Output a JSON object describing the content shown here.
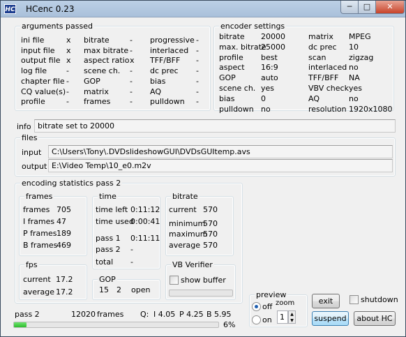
{
  "window": {
    "icon_text": "HC",
    "title": "HCenc 0.23",
    "minimize": "─",
    "maximize": "□",
    "close": "✕"
  },
  "args": {
    "legend": "arguments passed",
    "col1": [
      {
        "label": "ini file",
        "val": "x"
      },
      {
        "label": "input file",
        "val": "x"
      },
      {
        "label": "output file",
        "val": "x"
      },
      {
        "label": "log file",
        "val": "-"
      },
      {
        "label": "chapter file",
        "val": "-"
      },
      {
        "label": "CQ value(s)",
        "val": "-"
      },
      {
        "label": "profile",
        "val": "-"
      }
    ],
    "col2": [
      {
        "label": "bitrate",
        "val": "-"
      },
      {
        "label": "max bitrate",
        "val": "-"
      },
      {
        "label": "aspect ratio",
        "val": "x"
      },
      {
        "label": "scene ch.",
        "val": "-"
      },
      {
        "label": "GOP",
        "val": "-"
      },
      {
        "label": "matrix",
        "val": "-"
      },
      {
        "label": "frames",
        "val": "-"
      }
    ],
    "col3": [
      {
        "label": "progressive",
        "val": "-"
      },
      {
        "label": "interlaced",
        "val": "-"
      },
      {
        "label": "TFF/BFF",
        "val": "-"
      },
      {
        "label": "dc prec",
        "val": "-"
      },
      {
        "label": "bias",
        "val": "-"
      },
      {
        "label": "AQ",
        "val": "-"
      },
      {
        "label": "pulldown",
        "val": "-"
      }
    ]
  },
  "settings": {
    "legend": "encoder settings",
    "col1": [
      {
        "label": "bitrate",
        "val": "20000"
      },
      {
        "label": "max. bitrate",
        "val": "25000"
      },
      {
        "label": "profile",
        "val": "best"
      },
      {
        "label": "aspect",
        "val": "16:9"
      },
      {
        "label": "GOP",
        "val": "auto"
      },
      {
        "label": "scene ch.",
        "val": "yes"
      },
      {
        "label": "bias",
        "val": "0"
      },
      {
        "label": "pulldown",
        "val": "no"
      }
    ],
    "col2": [
      {
        "label": "matrix",
        "val": "MPEG"
      },
      {
        "label": "dc prec",
        "val": "10"
      },
      {
        "label": "scan",
        "val": "zigzag"
      },
      {
        "label": "interlaced",
        "val": "no"
      },
      {
        "label": "TFF/BFF",
        "val": "NA"
      },
      {
        "label": "VBV check",
        "val": "yes"
      },
      {
        "label": "AQ",
        "val": "no"
      },
      {
        "label": "resolution",
        "val": "1920x1080"
      }
    ]
  },
  "info": {
    "label": "info",
    "value": "bitrate set to  20000"
  },
  "files": {
    "legend": "files",
    "input_label": "input",
    "input_value": "C:\\Users\\Tony\\.DVDslideshowGUI\\DVDsGUItemp.avs",
    "output_label": "output",
    "output_value": "E:\\Video Temp\\10_e0.m2v"
  },
  "stats": {
    "legend": "encoding statistics pass 2",
    "frames": {
      "legend": "frames",
      "rows": [
        {
          "label": "frames",
          "val": "705"
        },
        {
          "label": "I frames",
          "val": "47"
        },
        {
          "label": "P frames",
          "val": "189"
        },
        {
          "label": "B frames",
          "val": "469"
        }
      ]
    },
    "time": {
      "legend": "time",
      "rows": [
        {
          "label": "time left",
          "val": "0:11:12"
        },
        {
          "label": "time used",
          "val": "0:00:41"
        },
        {
          "label": "pass 1",
          "val": "0:11:11"
        },
        {
          "label": "pass 2",
          "val": "-"
        },
        {
          "label": "total",
          "val": "-"
        }
      ]
    },
    "bitrate": {
      "legend": "bitrate",
      "rows": [
        {
          "label": "current",
          "val": "570"
        },
        {
          "label": "minimum",
          "val": "570"
        },
        {
          "label": "maximum",
          "val": "570"
        },
        {
          "label": "average",
          "val": "570"
        }
      ]
    },
    "fps": {
      "legend": "fps",
      "rows": [
        {
          "label": "current",
          "val": "17.2"
        },
        {
          "label": "average",
          "val": "17.2"
        }
      ]
    },
    "gop": {
      "legend": "GOP",
      "a": "15",
      "b": "2",
      "c": "open"
    },
    "vb": {
      "legend": "VB Verifier",
      "show_buffer": "show buffer"
    }
  },
  "preview": {
    "legend": "preview",
    "zoom_label": "zoom",
    "off": "off",
    "on": "on",
    "zoom_value": "1",
    "up": "▲",
    "down": "▼"
  },
  "buttons": {
    "exit": "exit",
    "shutdown": "shutdown",
    "suspend": "suspend",
    "about": "about  HC"
  },
  "status": {
    "pass": "pass 2",
    "frames_count": "12020",
    "frames_label": "frames",
    "q_label": "Q:",
    "q_i": "I 4.05",
    "q_p": "P 4.25",
    "q_b": "B 5.95",
    "percent_text": "6%",
    "progress_fraction": 0.06
  },
  "colors": {
    "progress": "#2fbb2f",
    "titlebar": "#a9c0da",
    "close": "#c7432a"
  }
}
